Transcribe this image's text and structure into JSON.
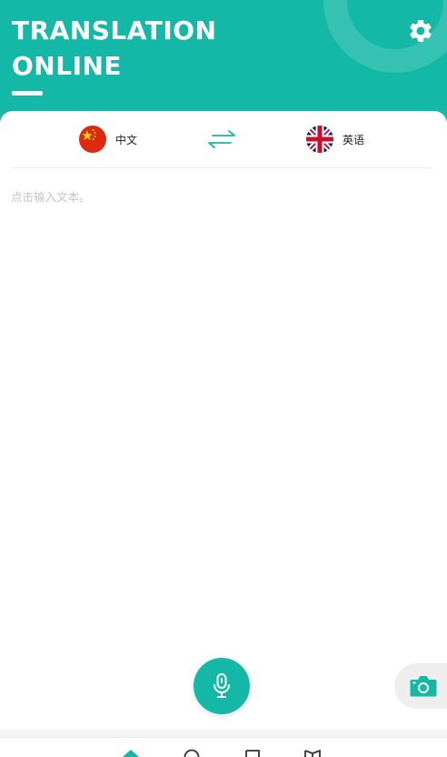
{
  "header": {
    "title_line1": "TRANSLATION",
    "title_line2": "ONLINE"
  },
  "languages": {
    "source": {
      "label": "中文",
      "flag": "china-flag"
    },
    "target": {
      "label": "英语",
      "flag": "uk-flag"
    }
  },
  "input": {
    "placeholder": "点击输入文本。",
    "value": ""
  },
  "colors": {
    "accent": "#14b8a6",
    "background": "#f3f3f3",
    "card": "#ffffff"
  },
  "bottom_nav": {
    "items": [
      {
        "icon": "home-icon",
        "active": true
      },
      {
        "icon": "search-icon",
        "active": false
      },
      {
        "icon": "bookmark-icon",
        "active": false
      },
      {
        "icon": "book-icon",
        "active": false
      }
    ]
  }
}
